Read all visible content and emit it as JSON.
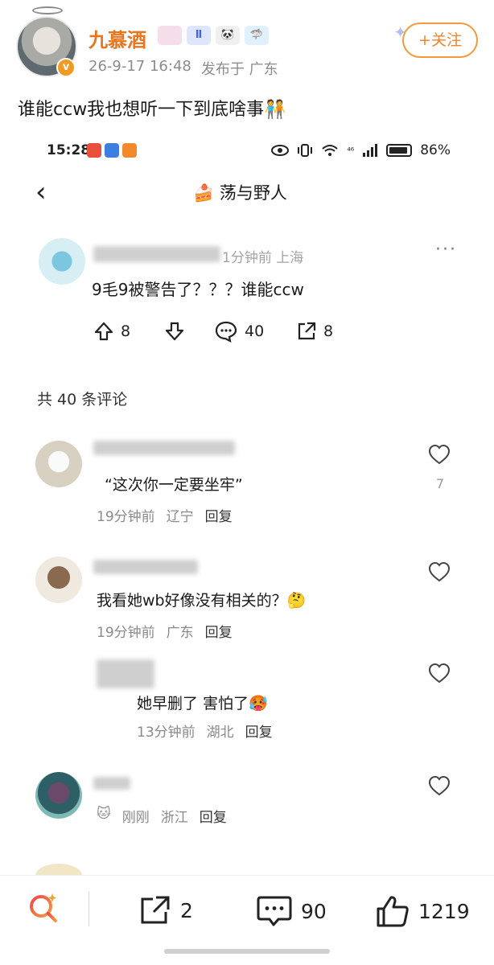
{
  "post": {
    "user_name": "九慕酒",
    "badge_labels": [
      "",
      "Ⅱ",
      "🐼",
      "🦈"
    ],
    "verified_label": "v",
    "time": "26-9-17 16:48",
    "location": "发布于 广东",
    "follow_label": "+关注",
    "text": "谁能ccw我也想听一下到底啥事🧑‍🤝‍🧑"
  },
  "embed": {
    "status_bar": {
      "time": "15:28",
      "battery": "86%",
      "network": "⁴⁶"
    },
    "nav": {
      "back": "‹",
      "title": "🍰 荡与野人"
    },
    "original_post": {
      "time_location": "1分钟前 上海",
      "text": "9毛9被警告了？？？谁能ccw",
      "upvotes": "8",
      "comments": "40",
      "shares": "8",
      "more": "···"
    },
    "comment_count": "共 40 条评论",
    "comments": [
      {
        "text": "“这次你一定要坐牢”",
        "time": "19分钟前",
        "location": "辽宁",
        "reply": "回复",
        "likes": "7"
      },
      {
        "text": "我看她wb好像没有相关的？🤔",
        "time": "19分钟前",
        "location": "广东",
        "reply": "回复",
        "likes": ""
      },
      {
        "text": "她早删了 害怕了🥵",
        "time": "13分钟前",
        "location": "湖北",
        "reply": "回复",
        "likes": ""
      },
      {
        "text": "",
        "prefix": "🐱",
        "time": "刚刚",
        "location": "浙江",
        "reply": "回复",
        "likes": ""
      }
    ]
  },
  "bottom_bar": {
    "shares": "2",
    "comments": "90",
    "likes": "1219"
  },
  "colors": {
    "accent_orange": "#e8761d",
    "follow_border": "#f39a3d",
    "text_gray": "#8c8c8c"
  }
}
